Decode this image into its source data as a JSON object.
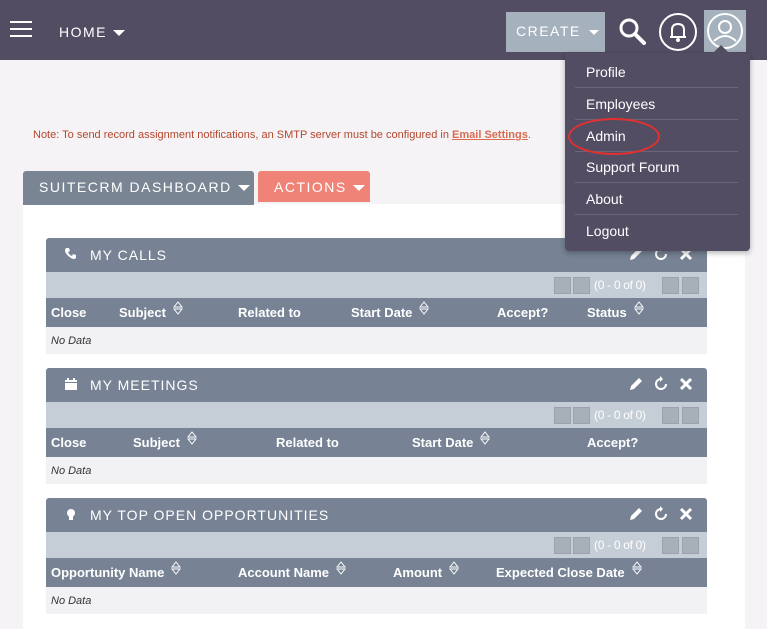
{
  "topbar": {
    "home_label": "HOME",
    "create_label": "CREATE"
  },
  "user_menu": {
    "items": [
      {
        "label": "Profile"
      },
      {
        "label": "Employees"
      },
      {
        "label": "Admin"
      },
      {
        "label": "Support Forum"
      },
      {
        "label": "About"
      },
      {
        "label": "Logout"
      }
    ]
  },
  "note": {
    "text": "Note: To send record assignment notifications, an SMTP server must be configured in",
    "link": "Email Settings",
    "suffix": "."
  },
  "dashboard": {
    "tab_label": "SUITECRM DASHBOARD",
    "actions_label": "ACTIONS"
  },
  "dashlets": [
    {
      "title": "MY CALLS",
      "pager": "(0 - 0 of 0)",
      "columns": [
        "Close",
        "Subject",
        "Related to",
        "Start Date",
        "Accept?",
        "Status"
      ],
      "empty": "No Data"
    },
    {
      "title": "MY MEETINGS",
      "pager": "(0 - 0 of 0)",
      "columns": [
        "Close",
        "Subject",
        "Related to",
        "Start Date",
        "Accept?"
      ],
      "empty": "No Data"
    },
    {
      "title": "MY TOP OPEN OPPORTUNITIES",
      "pager": "(0 - 0 of 0)",
      "columns": [
        "Opportunity Name",
        "Account Name",
        "Amount",
        "Expected Close Date"
      ],
      "empty": "No Data"
    }
  ],
  "colors": {
    "topbar": "#534d64",
    "accent_button": "#a5b1bd",
    "actions": "#f08377",
    "dashlet_header": "#778394",
    "highlight_circle": "#e3302f"
  }
}
